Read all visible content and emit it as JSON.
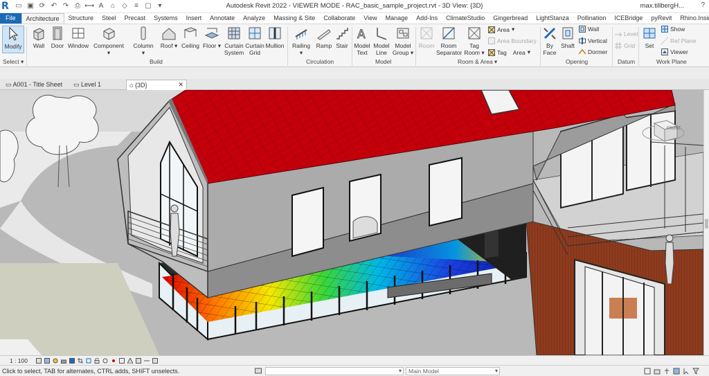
{
  "app": {
    "title": "Autodesk Revit 2022 - VIEWER MODE - RAC_basic_sample_project.rvt - 3D View: {3D}",
    "user": "max.tillbergH...",
    "logo_icon": "revit-logo-icon"
  },
  "ribbon_tabs": [
    "File",
    "Architecture",
    "Structure",
    "Steel",
    "Precast",
    "Systems",
    "Insert",
    "Annotate",
    "Analyze",
    "Massing & Site",
    "Collaborate",
    "View",
    "Manage",
    "Add-Ins",
    "ClimateStudio",
    "Gingerbread",
    "LightStanza",
    "Pollination",
    "ICEBridge",
    "pyRevit",
    "Rhino.Inside"
  ],
  "active_tab": "Architecture",
  "ribbon": {
    "select": {
      "modify": "Modify",
      "panel": "Select"
    },
    "build": {
      "panel": "Build",
      "wall": "Wall",
      "door": "Door",
      "window": "Window",
      "component": "Component",
      "column": "Column",
      "roof": "Roof",
      "ceiling": "Ceiling",
      "floor": "Floor",
      "curtain_system_1": "Curtain",
      "curtain_system_2": "System",
      "curtain_grid_1": "Curtain",
      "curtain_grid_2": "Grid",
      "mullion": "Mullion"
    },
    "circulation": {
      "panel": "Circulation",
      "railing": "Railing",
      "ramp": "Ramp",
      "stair": "Stair"
    },
    "model": {
      "panel": "Model",
      "model_text_1": "Model",
      "model_text_2": "Text",
      "model_line_1": "Model",
      "model_line_2": "Line",
      "model_group_1": "Model",
      "model_group_2": "Group"
    },
    "room_area": {
      "panel": "Room & Area",
      "room": "Room",
      "room_separator_1": "Room",
      "room_separator_2": "Separator",
      "tag_room_1": "Tag",
      "tag_room_2": "Room",
      "area": "Area",
      "area_boundary": "Area  Boundary",
      "tag": "Tag",
      "tag_area": "Area"
    },
    "opening": {
      "panel": "Opening",
      "by_face_1": "By",
      "by_face_2": "Face",
      "shaft": "Shaft",
      "wall": "Wall",
      "vertical": "Vertical",
      "dormer": "Dormer"
    },
    "datum": {
      "panel": "Datum",
      "level": "Level",
      "grid": "Grid"
    },
    "work_plane": {
      "panel": "Work Plane",
      "set": "Set",
      "show": "Show",
      "ref_plane": "Ref  Plane",
      "viewer": "Viewer"
    }
  },
  "view_tabs": [
    {
      "label": "A001 - Title Sheet",
      "active": false
    },
    {
      "label": "Level 1",
      "active": false
    },
    {
      "label": "{3D}",
      "active": true
    }
  ],
  "view_bar": {
    "scale": "1 : 100"
  },
  "status": {
    "message": "Click to select, TAB for alternates, CTRL adds, SHIFT unselects.",
    "model_combo": "Main Model"
  },
  "viewcube": {
    "label": "FRONT"
  },
  "colors": {
    "revit_blue": "#1b6ab5",
    "roof_red": "#c4000b",
    "selection_blue": "#cfe4f7",
    "siding_brown": "#8e3b1e"
  }
}
